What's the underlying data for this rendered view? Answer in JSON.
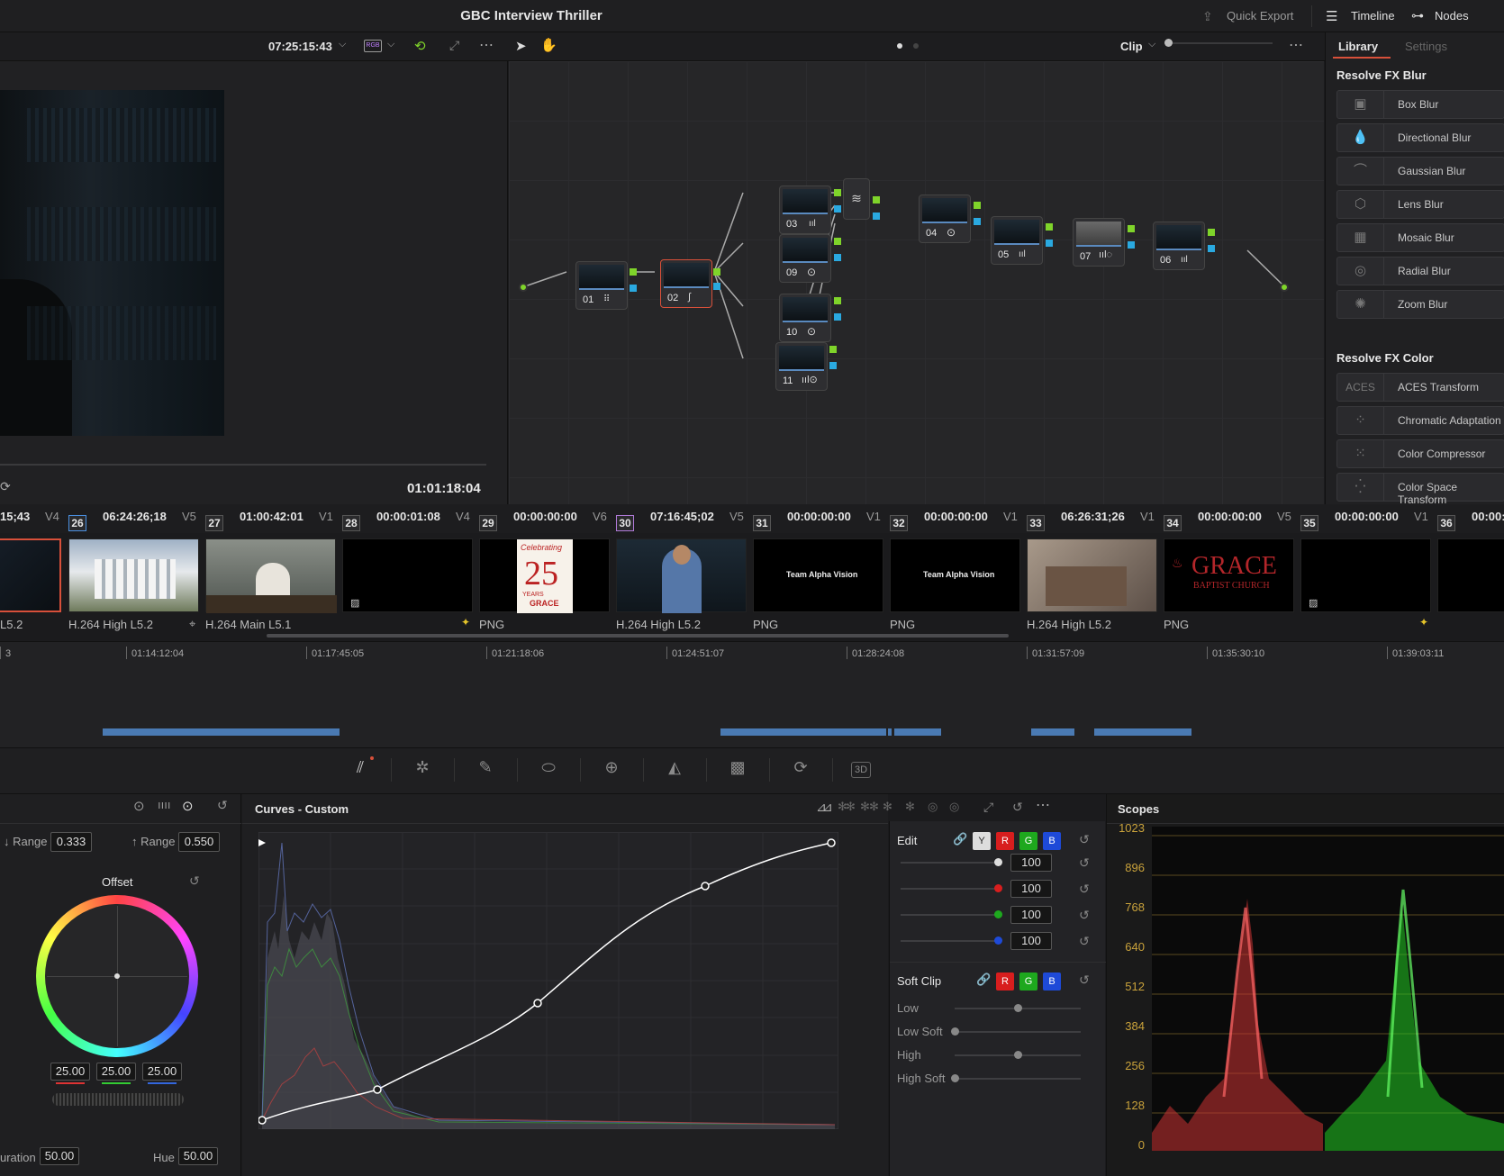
{
  "app": {
    "title": "GBC Interview Thriller",
    "quick_export": "Quick Export",
    "timeline_btn": "Timeline",
    "nodes_btn": "Nodes"
  },
  "viewer": {
    "timecode_top": "07:25:15:43",
    "timecode_bottom": "01:01:18:04",
    "clip_mode": "Clip"
  },
  "library": {
    "tab_library": "Library",
    "tab_settings": "Settings",
    "section_blur": "Resolve FX Blur",
    "blur_items": [
      "Box Blur",
      "Directional Blur",
      "Gaussian Blur",
      "Lens Blur",
      "Mosaic Blur",
      "Radial Blur",
      "Zoom Blur"
    ],
    "section_color": "Resolve FX Color",
    "color_items": [
      "ACES Transform",
      "Chromatic Adaptation",
      "Color Compressor",
      "Color Space Transform"
    ],
    "aces_text": "ACES"
  },
  "nodes": [
    "01",
    "02",
    "03",
    "09",
    "10",
    "11",
    "04",
    "05",
    "07",
    "06"
  ],
  "clips": {
    "headers": [
      {
        "track": "",
        "num": "",
        "tc": "15;43"
      },
      {
        "track": "V4",
        "num": "26",
        "tc": "06:24:26;18"
      },
      {
        "track": "V5",
        "num": "27",
        "tc": "01:00:42:01"
      },
      {
        "track": "V1",
        "num": "28",
        "tc": "00:00:01:08"
      },
      {
        "track": "V4",
        "num": "29",
        "tc": "00:00:00:00"
      },
      {
        "track": "V6",
        "num": "30",
        "tc": "07:16:45;02"
      },
      {
        "track": "V5",
        "num": "31",
        "tc": "00:00:00:00"
      },
      {
        "track": "V1",
        "num": "32",
        "tc": "00:00:00:00"
      },
      {
        "track": "V1",
        "num": "33",
        "tc": "06:26:31;26"
      },
      {
        "track": "V1",
        "num": "34",
        "tc": "00:00:00:00"
      },
      {
        "track": "V5",
        "num": "35",
        "tc": "00:00:00:00"
      },
      {
        "track": "V1",
        "num": "36",
        "tc": "00:00:"
      }
    ],
    "labels": [
      "L5.2",
      "H.264 High L5.2",
      "H.264 Main L5.1",
      "",
      "PNG",
      "H.264 High L5.2",
      "PNG",
      "PNG",
      "H.264 High L5.2",
      "PNG",
      "",
      ""
    ],
    "thumb_texts": {
      "celebrating": "Celebrating",
      "twentyfive": "25",
      "years": "YEARS",
      "grace_small": "GRACE",
      "team_alpha": "Team Alpha Vision",
      "grace": "GRACE",
      "baptist": "BAPTIST CHURCH"
    }
  },
  "timeline": {
    "ticks": [
      "3",
      "01:14:12:04",
      "01:17:45:05",
      "01:21:18:06",
      "01:24:51:07",
      "01:28:24:08",
      "01:31:57:09",
      "01:35:30:10",
      "01:39:03:11"
    ]
  },
  "wheels": {
    "low_range_label": "↓ Range",
    "low_range": "0.333",
    "high_range_label": "↑ Range",
    "high_range": "0.550",
    "offset_label": "Offset",
    "r": "25.00",
    "g": "25.00",
    "b": "25.00",
    "saturation_label": "uration",
    "saturation": "50.00",
    "hue_label": "Hue",
    "hue": "50.00"
  },
  "curves": {
    "title": "Curves - Custom"
  },
  "edit": {
    "label": "Edit",
    "y": "Y",
    "r": "R",
    "g": "G",
    "b": "B",
    "values": [
      "100",
      "100",
      "100",
      "100"
    ],
    "soft_clip_label": "Soft Clip",
    "low": "Low",
    "low_soft": "Low Soft",
    "high": "High",
    "high_soft": "High Soft"
  },
  "scopes": {
    "title": "Scopes",
    "levels": [
      "1023",
      "896",
      "768",
      "640",
      "512",
      "384",
      "256",
      "128",
      "0"
    ]
  },
  "colors": {
    "accent_red": "#d8503a",
    "accent_green": "#7fd42a",
    "accent_blue": "#2aa9e0",
    "scope_yellow": "#c9a23b"
  }
}
